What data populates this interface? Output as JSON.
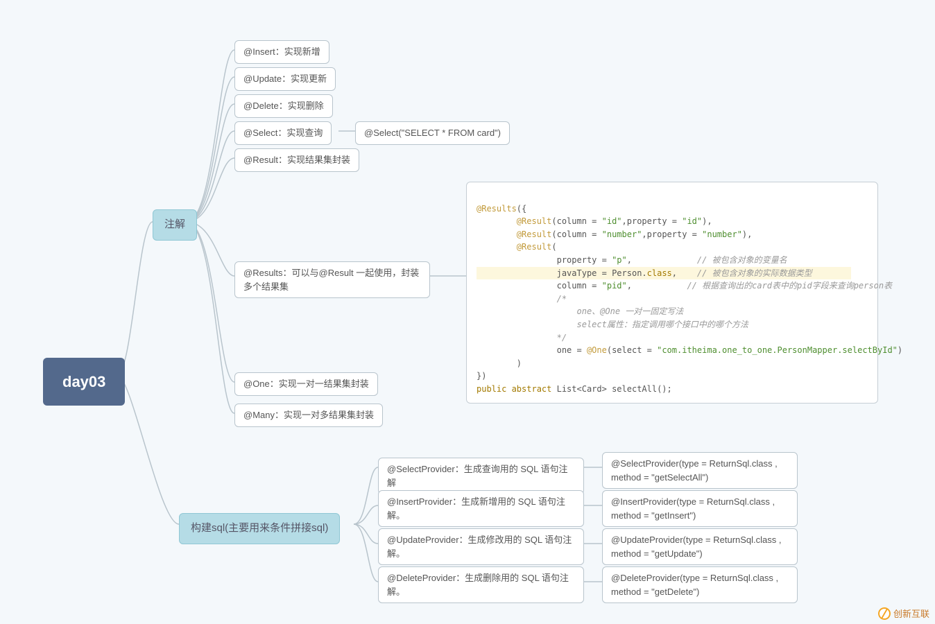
{
  "root": {
    "label": "day03"
  },
  "branch1": {
    "label": "注解"
  },
  "branch2": {
    "label": "构建sql(主要用来条件拼接sql)"
  },
  "nodes": {
    "insert": "@Insert：实现新增",
    "update": "@Update：实现更新",
    "delete": "@Delete：实现删除",
    "select": "@Select：实现查询",
    "select_sub": "@Select(\"SELECT * FROM card\")",
    "result": "@Result：实现结果集封装",
    "results": "@Results：可以与@Result 一起使用，封装多个结果集",
    "one": "@One：实现一对一结果集封装",
    "many": "@Many：实现一对多结果集封装",
    "selProv": "@SelectProvider：生成查询用的 SQL 语句注解",
    "selProv_sub": "@SelectProvider(type = ReturnSql.class , method = \"getSelectAll\")",
    "insProv": "@InsertProvider：生成新增用的 SQL 语句注解。",
    "insProv_sub": "@InsertProvider(type = ReturnSql.class , method = \"getInsert\")",
    "updProv": "@UpdateProvider：生成修改用的 SQL 语句注解。",
    "updProv_sub": "@UpdateProvider(type = ReturnSql.class , method = \"getUpdate\")",
    "delProv": "@DeleteProvider：生成删除用的 SQL 语句注解。",
    "delProv_sub": "@DeleteProvider(type = ReturnSql.class , method = \"getDelete\")"
  },
  "code": {
    "l1a": "@Results",
    "l1b": "({",
    "l2a": "        @Result",
    "l2b": "(column = ",
    "l2c": "\"id\"",
    "l2d": ",property = ",
    "l2e": "\"id\"",
    "l2f": "),",
    "l3a": "        @Result",
    "l3b": "(column = ",
    "l3c": "\"number\"",
    "l3d": ",property = ",
    "l3e": "\"number\"",
    "l3f": "),",
    "l4a": "        @Result",
    "l4b": "(",
    "l5a": "                property = ",
    "l5b": "\"p\"",
    "l5c": ",             ",
    "l5d": "// 被包含对象的变量名",
    "l6a": "                javaType = Person.",
    "l6b": "class",
    "l6c": ",    ",
    "l6d": "// 被包含对象的实际数据类型",
    "l7a": "                column = ",
    "l7b": "\"pid\"",
    "l7c": ",           ",
    "l7d": "// 根据查询出的card表中的pid字段来查询person表",
    "l8": "                /*",
    "l9": "                    one、@One 一对一固定写法",
    "l10": "                    select属性：指定调用哪个接口中的哪个方法",
    "l11": "                */",
    "l12a": "                one = ",
    "l12b": "@One",
    "l12c": "(select = ",
    "l12d": "\"com.itheima.one_to_one.PersonMapper.selectById\"",
    "l12e": ")",
    "l13": "        )",
    "l14": "})",
    "l15a": "public abstract ",
    "l15b": "List<Card> selectAll();"
  },
  "watermark": "创新互联"
}
